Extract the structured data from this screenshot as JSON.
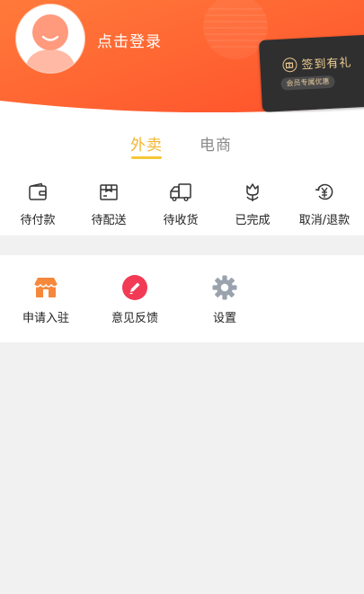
{
  "header": {
    "login_text": "点击登录",
    "vip_card": {
      "title": "签到有礼",
      "subtitle": "会员专属优惠"
    },
    "colors": {
      "gradient_start": "#ff7a3a",
      "gradient_end": "#ff4f2a",
      "card": "#2f2f30",
      "gold": "#f1cf93"
    }
  },
  "orders": {
    "tabs": [
      {
        "label": "外卖",
        "active": true
      },
      {
        "label": "电商",
        "active": false
      }
    ],
    "items": [
      {
        "label": "待付款",
        "icon": "wallet-icon"
      },
      {
        "label": "待配送",
        "icon": "package-icon"
      },
      {
        "label": "待收货",
        "icon": "delivery-truck-icon"
      },
      {
        "label": "已完成",
        "icon": "flower-icon"
      },
      {
        "label": "取消/退款",
        "icon": "refund-yuan-icon"
      }
    ],
    "accent_color": "#f2b52d"
  },
  "services": {
    "items": [
      {
        "label": "申请入驻",
        "icon": "store-icon"
      },
      {
        "label": "意见反馈",
        "icon": "feedback-pen-icon"
      },
      {
        "label": "设置",
        "icon": "settings-gear-icon"
      }
    ]
  }
}
